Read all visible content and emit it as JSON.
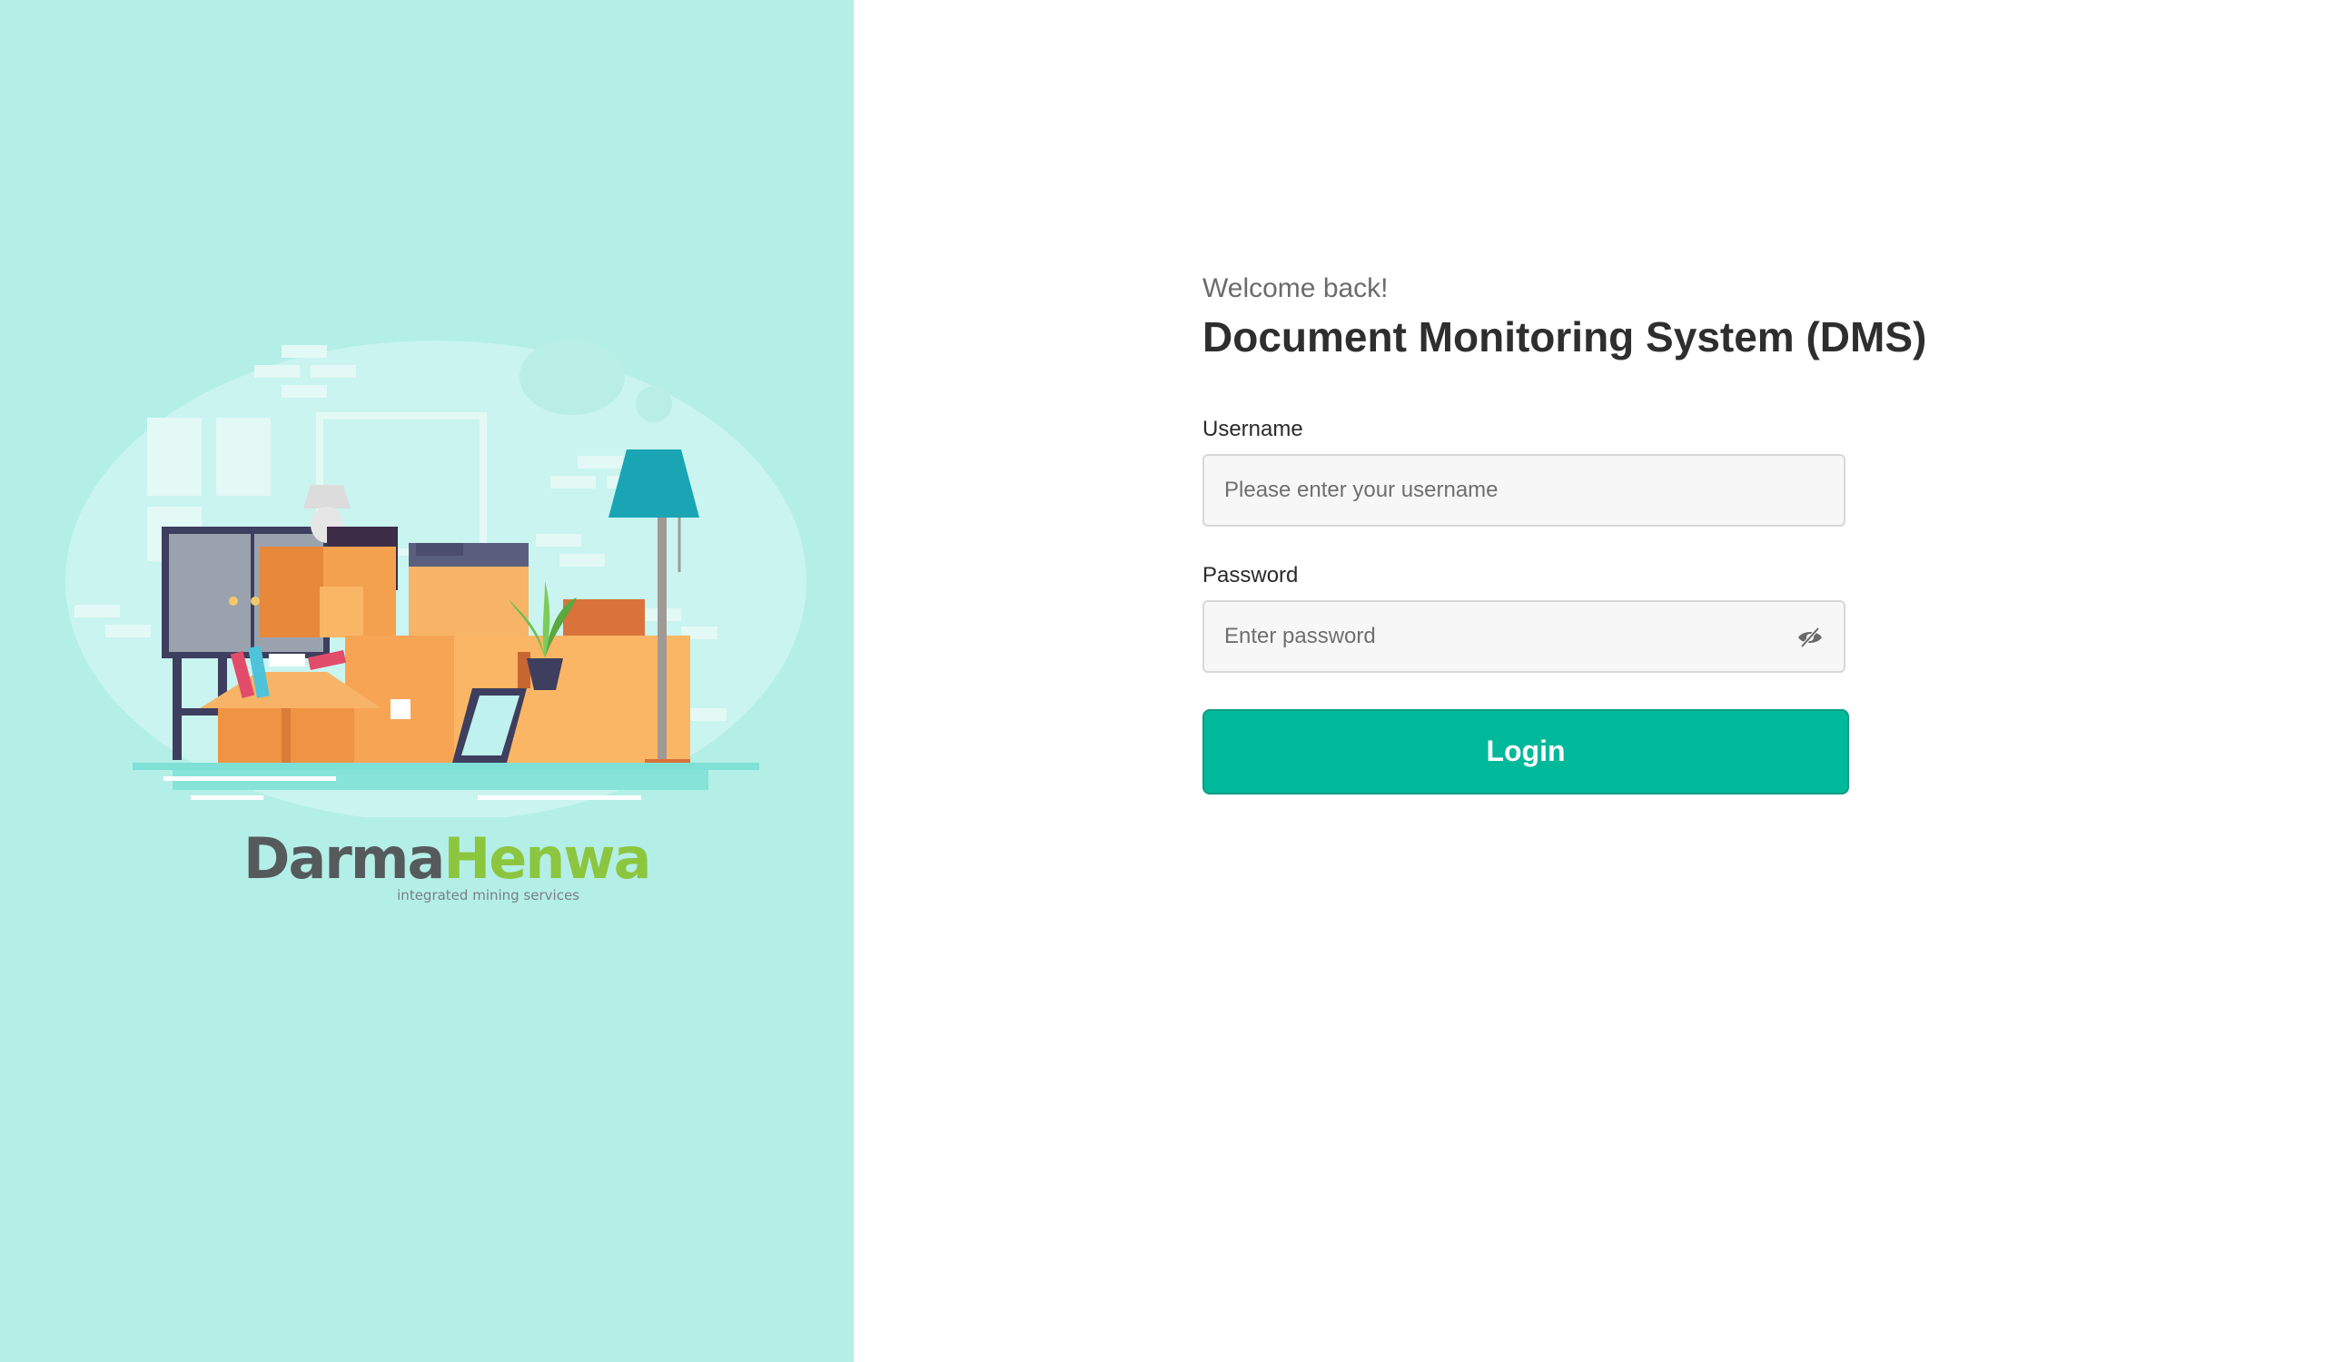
{
  "brand": {
    "logo_dark": "Darma",
    "logo_green": "Henwa",
    "tagline": "integrated mining services",
    "colors": {
      "dark": "#555a5c",
      "green": "#8cc63f",
      "panel_bg": "#b3efe6"
    }
  },
  "login": {
    "welcome": "Welcome back!",
    "title": "Document Monitoring System (DMS)",
    "username": {
      "label": "Username",
      "placeholder": "Please enter your username",
      "value": ""
    },
    "password": {
      "label": "Password",
      "placeholder": "Enter password",
      "value": "",
      "toggle_icon": "eye-slash-icon"
    },
    "submit_label": "Login",
    "accent_color": "#00b89a"
  }
}
